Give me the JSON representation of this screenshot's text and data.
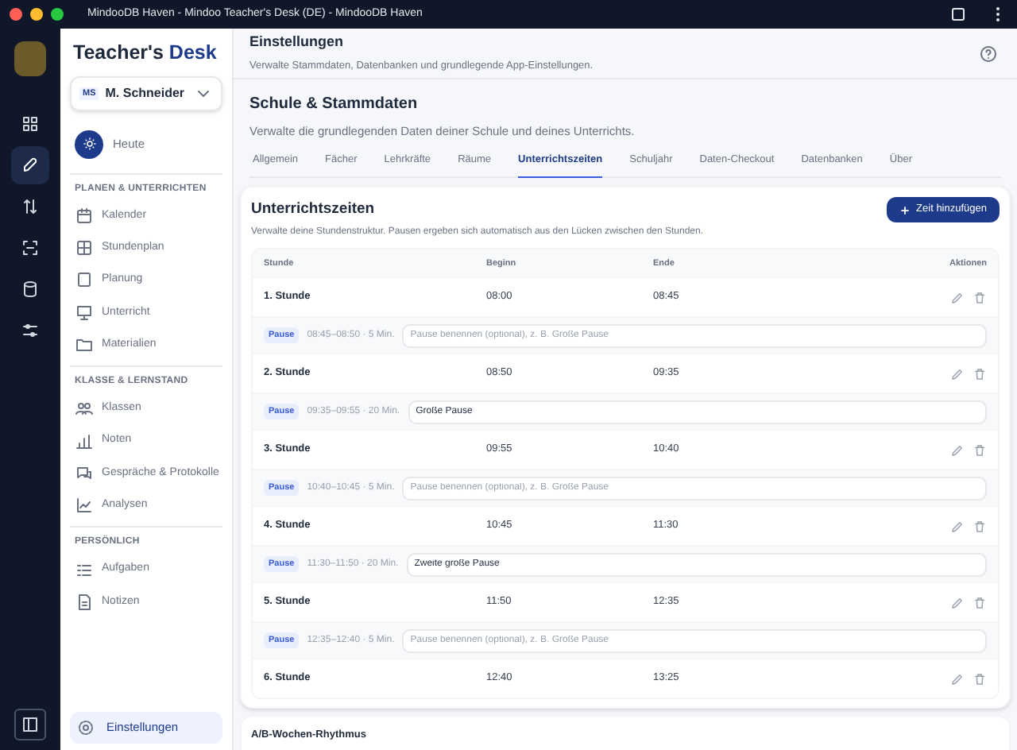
{
  "window": {
    "title": "MindooDB Haven - Mindoo Teacher's Desk (DE) - MindooDB Haven"
  },
  "rail": [
    {
      "selected": false
    },
    {
      "selected": true
    },
    {
      "selected": false
    },
    {
      "selected": false
    },
    {
      "selected": false
    },
    {
      "selected": false
    }
  ],
  "sidebar": {
    "brand_first": "Teacher's",
    "brand_second": "Desk",
    "user": {
      "initials": "MS",
      "name": "M. Schneider"
    },
    "today": "Heute",
    "sections": [
      {
        "title": "PLANEN & UNTERRICHTEN",
        "items": [
          {
            "label": "Kalender",
            "selected": false
          },
          {
            "label": "Stundenplan",
            "selected": false
          },
          {
            "label": "Planung",
            "selected": false
          },
          {
            "label": "Unterricht",
            "selected": false
          },
          {
            "label": "Materialien",
            "selected": false
          }
        ]
      },
      {
        "title": "KLASSE & LERNSTAND",
        "items": [
          {
            "label": "Klassen",
            "selected": false
          },
          {
            "label": "Noten",
            "selected": false
          },
          {
            "label": "Gespräche & Protokolle",
            "selected": false
          },
          {
            "label": "Analysen",
            "selected": false
          }
        ]
      },
      {
        "title": "PERSÖNLICH",
        "items": [
          {
            "label": "Aufgaben",
            "selected": false
          },
          {
            "label": "Notizen",
            "selected": false
          }
        ]
      }
    ],
    "footer": {
      "label": "Einstellungen",
      "selected": true
    }
  },
  "header": {
    "title": "Einstellungen",
    "subtitle": "Verwalte Stammdaten, Datenbanken und grundlegende App-Einstellungen."
  },
  "section": {
    "title": "Schule & Stammdaten",
    "subtitle": "Verwalte die grundlegenden Daten deiner Schule und deines Unterrichts.",
    "tabs": [
      {
        "label": "Allgemein",
        "selected": false
      },
      {
        "label": "Fächer",
        "selected": false
      },
      {
        "label": "Lehrkräfte",
        "selected": false
      },
      {
        "label": "Räume",
        "selected": false
      },
      {
        "label": "Unterrichtszeiten",
        "selected": true
      },
      {
        "label": "Schuljahr",
        "selected": false
      },
      {
        "label": "Daten-Checkout",
        "selected": false
      },
      {
        "label": "Datenbanken",
        "selected": false
      },
      {
        "label": "Über",
        "selected": false
      }
    ]
  },
  "card": {
    "title": "Unterrichtszeiten",
    "subtitle": "Verwalte deine Stundenstruktur. Pausen ergeben sich automatisch aus den Lücken zwischen den Stunden.",
    "add_button": "Zeit hinzufügen",
    "columns": [
      "Stunde",
      "Beginn",
      "Ende",
      "Aktionen"
    ],
    "rows": [
      {
        "kind": "lesson",
        "name": "1. Stunde",
        "start": "08:00",
        "end": "08:45"
      },
      {
        "kind": "pause",
        "badge": "Pause",
        "span": "08:45–08:50 · 5 Min.",
        "placeholder": "Pause benennen (optional), z. B. Große Pause"
      },
      {
        "kind": "lesson",
        "name": "2. Stunde",
        "start": "08:50",
        "end": "09:35"
      },
      {
        "kind": "pause",
        "badge": "Pause",
        "span": "09:35–09:55 · 20 Min.",
        "value": "Große Pause"
      },
      {
        "kind": "lesson",
        "name": "3. Stunde",
        "start": "09:55",
        "end": "10:40"
      },
      {
        "kind": "pause",
        "badge": "Pause",
        "span": "10:40–10:45 · 5 Min.",
        "placeholder": "Pause benennen (optional), z. B. Große Pause"
      },
      {
        "kind": "lesson",
        "name": "4. Stunde",
        "start": "10:45",
        "end": "11:30"
      },
      {
        "kind": "pause",
        "badge": "Pause",
        "span": "11:30–11:50 · 20 Min.",
        "value": "Zweite große Pause"
      },
      {
        "kind": "lesson",
        "name": "5. Stunde",
        "start": "11:50",
        "end": "12:35"
      },
      {
        "kind": "pause",
        "badge": "Pause",
        "span": "12:35–12:40 · 5 Min.",
        "placeholder": "Pause benennen (optional), z. B. Große Pause"
      },
      {
        "kind": "lesson",
        "name": "6. Stunde",
        "start": "12:40",
        "end": "13:25"
      }
    ]
  },
  "next_section": {
    "title": "A/B-Wochen-Rhythmus"
  }
}
